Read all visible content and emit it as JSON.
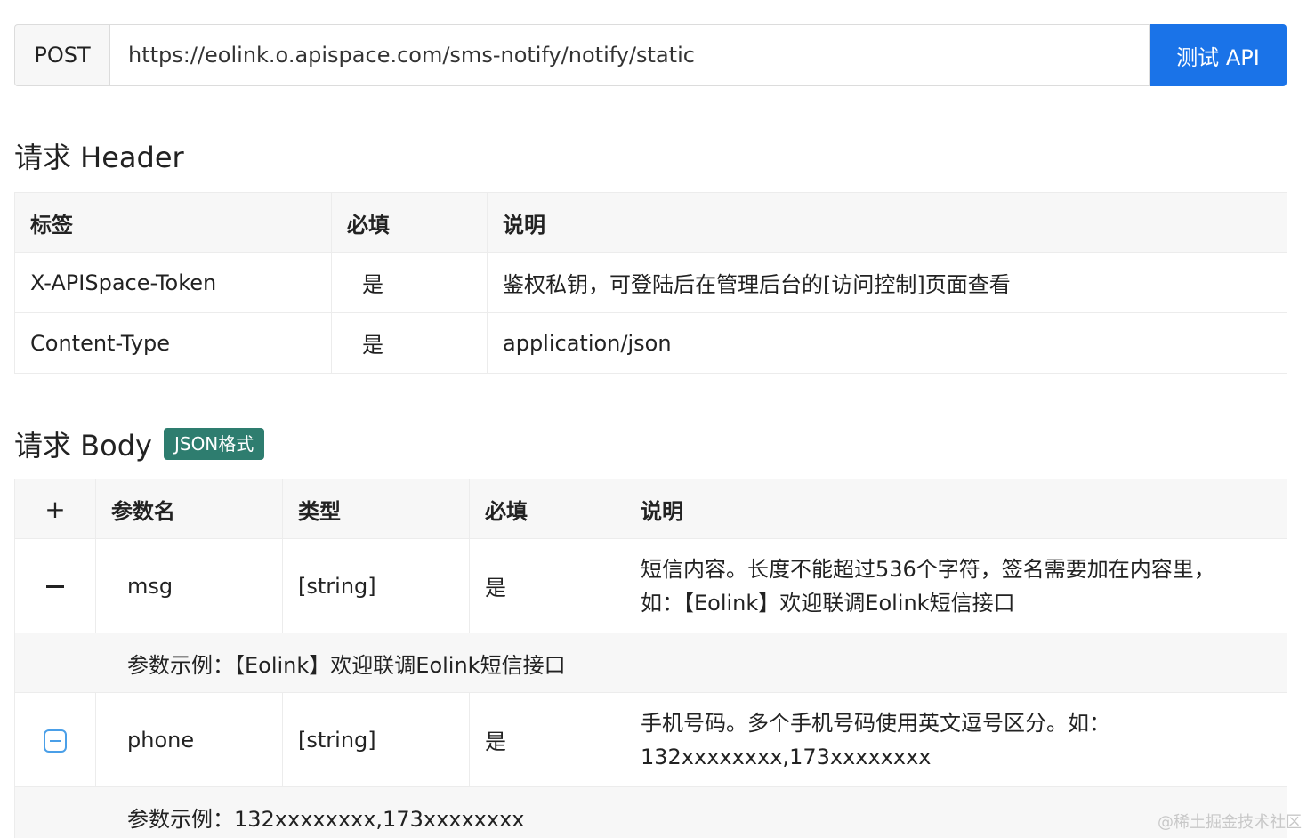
{
  "request": {
    "method": "POST",
    "url": "https://eolink.o.apispace.com/sms-notify/notify/static",
    "test_button": "测试 API"
  },
  "header_section": {
    "title": "请求 Header",
    "columns": [
      "标签",
      "必填",
      "说明"
    ],
    "rows": [
      {
        "label": "X-APISpace-Token",
        "required": "是",
        "desc": "鉴权私钥，可登陆后在管理后台的[访问控制]页面查看"
      },
      {
        "label": "Content-Type",
        "required": "是",
        "desc": "application/json"
      }
    ]
  },
  "body_section": {
    "title": "请求 Body",
    "badge": "JSON格式",
    "expand_all": "+",
    "columns": [
      "参数名",
      "类型",
      "必填",
      "说明"
    ],
    "params": [
      {
        "name": "msg",
        "type": "[string]",
        "required": "是",
        "desc_line1": "短信内容。长度不能超过536个字符，签名需要加在内容里，",
        "desc_line2": "如：【Eolink】欢迎联调Eolink短信接口",
        "example": "参数示例：【Eolink】欢迎联调Eolink短信接口",
        "collapse_icon": "minus-icon"
      },
      {
        "name": "phone",
        "type": "[string]",
        "required": "是",
        "desc_line1": "手机号码。多个手机号码使用英文逗号区分。如：",
        "desc_line2": "132xxxxxxxx,173xxxxxxxx",
        "example": "参数示例：132xxxxxxxx,173xxxxxxxx",
        "collapse_icon": "minus-square-icon"
      }
    ]
  },
  "watermark": "@稀土掘金技术社区",
  "colors": {
    "primary_button": "#1a73e8",
    "badge": "#2e7d6f",
    "collapse_icon_blue": "#4a9fe8"
  }
}
